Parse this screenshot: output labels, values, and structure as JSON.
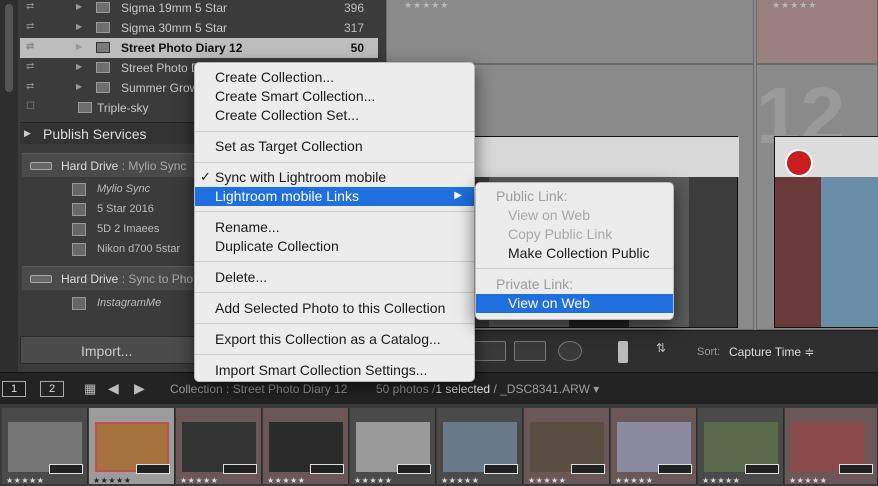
{
  "collections": [
    {
      "name": "Sigma 19mm 5 Star",
      "count": "396"
    },
    {
      "name": "Sigma 30mm 5 Star",
      "count": "317"
    },
    {
      "name": "Street Photo Diary 12",
      "count": "50"
    },
    {
      "name": "Street Photo D",
      "count": ""
    },
    {
      "name": "Summer Grow",
      "count": ""
    },
    {
      "name": "Triple-sky",
      "count": ""
    }
  ],
  "publish": {
    "header": "Publish Services",
    "hard_drive_1": {
      "name": "Hard Drive",
      "sub": ": Mylio Sync"
    },
    "hard_drive_1_items": [
      "Mylio Sync",
      "5 Star 2016",
      "5D 2 Imaees",
      "Nikon d700 5star"
    ],
    "hard_drive_2": {
      "name": "Hard Drive",
      "sub": ": Sync to Phot"
    },
    "hard_drive_2_items": [
      "InstagramMe"
    ]
  },
  "import_label": "Import...",
  "grid": {
    "number": "12",
    "sort_label": "Sort:",
    "sort_value": "Capture Time ≑"
  },
  "filmstrip_header": {
    "monitor1": "1",
    "monitor2": "2",
    "path": "Collection : Street Photo Diary 12",
    "count_prefix": "50 photos /",
    "count_selected": "1 selected",
    "count_suffix": "/ _DSC8341.ARW ▾"
  },
  "context_menu": {
    "items": [
      "Create Collection...",
      "Create Smart Collection...",
      "Create Collection Set...",
      "Set as Target Collection",
      "Sync with Lightroom mobile",
      "Lightroom mobile Links",
      "Rename...",
      "Duplicate Collection",
      "Delete...",
      "Add Selected Photo to this Collection",
      "Export this Collection as a Catalog...",
      "Import Smart Collection Settings..."
    ],
    "check_mark": "✓",
    "submenu_arrow": "▶"
  },
  "submenu": {
    "public_header": "Public Link:",
    "public_view": "View on Web",
    "public_copy": "Copy Public Link",
    "make_public": "Make Collection Public",
    "private_header": "Private Link:",
    "private_view": "View on Web"
  },
  "stars": "★★★★★",
  "colors": {
    "highlight": "#1f6fe0",
    "menu_bg": "#ececec",
    "panel_bg": "#3b3b3b"
  }
}
